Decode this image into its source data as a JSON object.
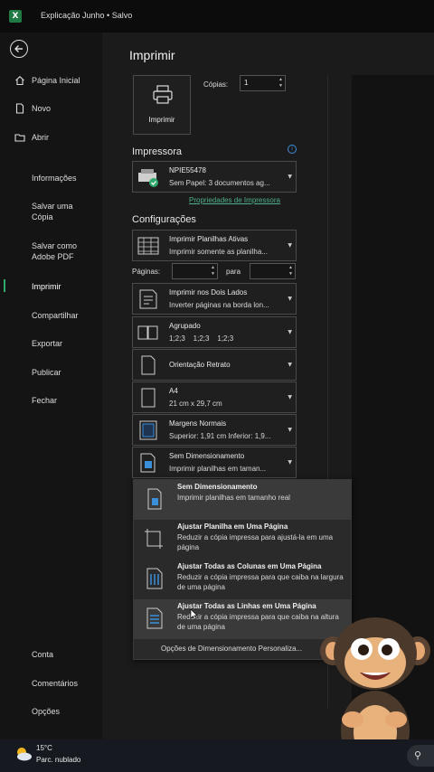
{
  "window": {
    "title": "Explicação Junho • Salvo",
    "app_icon": "X"
  },
  "sidebar": {
    "items": [
      {
        "label": "Página Inicial",
        "icon": "home-icon"
      },
      {
        "label": "Novo",
        "icon": "new-file-icon"
      },
      {
        "label": "Abrir",
        "icon": "folder-icon"
      },
      {
        "label": "Informações"
      },
      {
        "label": "Salvar uma Cópia"
      },
      {
        "label": "Salvar como Adobe PDF"
      },
      {
        "label": "Imprimir",
        "active": true
      },
      {
        "label": "Compartilhar"
      },
      {
        "label": "Exportar"
      },
      {
        "label": "Publicar"
      },
      {
        "label": "Fechar"
      },
      {
        "label": "Conta"
      },
      {
        "label": "Comentários"
      },
      {
        "label": "Opções"
      }
    ]
  },
  "main": {
    "title": "Imprimir",
    "print_button": "Imprimir",
    "copies_label": "Cópias:",
    "copies_value": "1",
    "printer_section": "Impressora",
    "printer": {
      "name": "NPIE55478",
      "status": "Sem Papel: 3 documentos ag..."
    },
    "printer_properties": "Propriedades de Impressora",
    "settings_section": "Configurações",
    "scope": {
      "line1": "Imprimir Planilhas Ativas",
      "line2": "Imprimir somente as planilha..."
    },
    "pages_label": "Páginas:",
    "to_label": "para",
    "duplex": {
      "line1": "Imprimir nos Dois Lados",
      "line2": "Inverter páginas na borda lon..."
    },
    "collate": {
      "line1": "Agrupado",
      "line2": "1;2;3    1;2;3    1;2;3"
    },
    "orientation": {
      "line1": "Orientação Retrato"
    },
    "paper": {
      "line1": "A4",
      "line2": "21 cm x 29,7 cm"
    },
    "margins": {
      "line1": "Margens Normais",
      "line2": "Superior: 1,91 cm Inferior: 1,9..."
    },
    "scaling": {
      "line1": "Sem Dimensionamento",
      "line2": "Imprimir planilhas em taman..."
    }
  },
  "scaling_menu": {
    "options": [
      {
        "title": "Sem Dimensionamento",
        "desc": "Imprimir planilhas em tamanho real",
        "selected": true
      },
      {
        "title": "Ajustar Planilha em Uma Página",
        "desc": "Reduzir a cópia impressa para ajustá-la em uma página"
      },
      {
        "title": "Ajustar Todas as Colunas em Uma Página",
        "desc": "Reduzir a cópia impressa para que caiba na largura de uma página"
      },
      {
        "title": "Ajustar Todas as Linhas em Uma Página",
        "desc": "Reduzir a cópia impressa para que caiba na altura de uma página"
      }
    ],
    "footer": "Opções de Dimensionamento Personaliza..."
  },
  "taskbar": {
    "temperature": "15°C",
    "condition": "Parc. nublado"
  },
  "colors": {
    "accent": "#2fa86b",
    "link": "#4fb08a",
    "info": "#3b8fd9"
  }
}
